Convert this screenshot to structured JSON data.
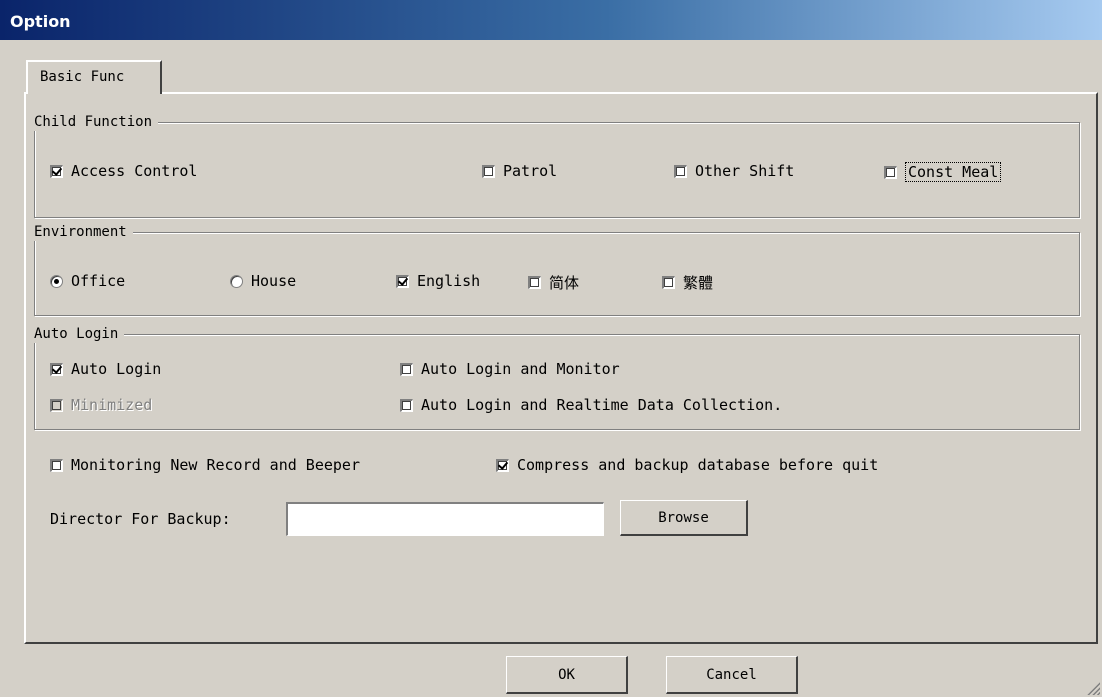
{
  "window": {
    "title": "Option"
  },
  "tabs": [
    {
      "label": "Basic Func"
    }
  ],
  "child_function": {
    "title": "Child Function",
    "items": [
      {
        "label": "Access Control",
        "checked": true
      },
      {
        "label": "Patrol",
        "checked": false
      },
      {
        "label": "Other Shift",
        "checked": false
      },
      {
        "label": "Const Meal",
        "checked": false,
        "focused": true
      }
    ]
  },
  "environment": {
    "title": "Environment",
    "radios": [
      {
        "label": "Office",
        "selected": true
      },
      {
        "label": "House",
        "selected": false
      }
    ],
    "languages": [
      {
        "label": "English",
        "checked": true
      },
      {
        "label": "简体",
        "checked": false
      },
      {
        "label": "繁體",
        "checked": false
      }
    ]
  },
  "auto_login": {
    "title": "Auto Login",
    "items": [
      {
        "label": "Auto Login",
        "checked": true,
        "disabled": false
      },
      {
        "label": "Minimized",
        "checked": false,
        "disabled": true
      },
      {
        "label": "Auto Login and Monitor",
        "checked": false,
        "disabled": false
      },
      {
        "label": "Auto Login and Realtime Data Collection.",
        "checked": false,
        "disabled": false
      }
    ]
  },
  "options": [
    {
      "label": "Monitoring New Record and Beeper",
      "checked": false
    },
    {
      "label": "Compress and backup database before quit",
      "checked": true
    }
  ],
  "backup": {
    "label": "Director For Backup:",
    "value": "",
    "browse_label": "Browse"
  },
  "footer": {
    "ok_label": "OK",
    "cancel_label": "Cancel"
  }
}
